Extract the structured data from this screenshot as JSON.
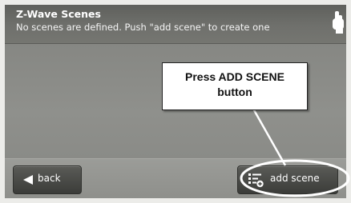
{
  "header": {
    "title": "Z-Wave Scenes",
    "subtitle": "No scenes are defined. Push \"add scene\" to create one"
  },
  "buttons": {
    "back_label": "back",
    "add_scene_label": "add scene"
  },
  "callout": {
    "line1": "Press ADD SCENE",
    "line2": "button"
  },
  "icons": {
    "corner": "hand-pointer-icon",
    "back": "left-arrow-icon",
    "add_scene": "list-add-icon"
  },
  "colors": {
    "header_background": "#6f706c",
    "content_background": "#8b8c88",
    "button_background": "#4a4b47",
    "callout_background": "#ffffff"
  }
}
